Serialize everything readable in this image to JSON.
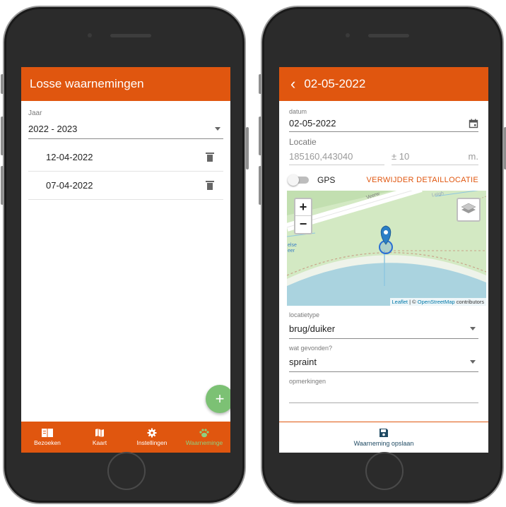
{
  "left_screen": {
    "app_title": "Losse waarnemingen",
    "year_label": "Jaar",
    "year_value": "2022 - 2023",
    "observations": [
      {
        "date": "12-04-2022"
      },
      {
        "date": "07-04-2022"
      }
    ],
    "fab_label": "+",
    "nav": [
      {
        "label": "Bezoeken",
        "icon": "book-icon"
      },
      {
        "label": "Kaart",
        "icon": "map-icon"
      },
      {
        "label": "Instellingen",
        "icon": "gear-icon"
      },
      {
        "label": "Waarneminge",
        "icon": "paw-icon"
      }
    ]
  },
  "right_screen": {
    "title": "02-05-2022",
    "date_label": "datum",
    "date_value": "02-05-2022",
    "location_label": "Locatie",
    "location_value": "185160,443040",
    "accuracy_prefix": "±",
    "accuracy_value": "10",
    "accuracy_unit": "m.",
    "gps_label": "GPS",
    "remove_location_label": "VERWIJDER DETAILLOCATIE",
    "map": {
      "zoom_in": "+",
      "zoom_out": "−",
      "street_label": "Veerw",
      "street_label_2": "Leigh",
      "place_label_1": "else",
      "place_label_2": "eer",
      "attribution_leaflet": "Leaflet",
      "attribution_sep": " | © ",
      "attribution_osm": "OpenStreetMap",
      "attribution_suffix": " contributors"
    },
    "location_type_label": "locatietype",
    "location_type_value": "brug/duiker",
    "found_label": "wat gevonden?",
    "found_value": "spraint",
    "remarks_label": "opmerkingen",
    "remarks_value": "",
    "save_label": "Waarneming opslaan"
  },
  "colors": {
    "brand_orange": "#e0560f",
    "fab_green": "#7cc174",
    "nav_active": "#8fd07f",
    "save_blue": "#1f4a63"
  }
}
